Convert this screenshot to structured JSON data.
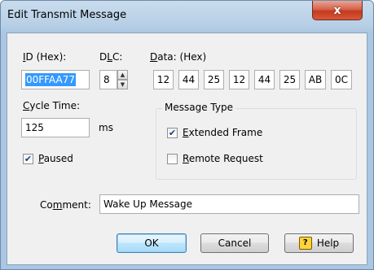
{
  "window": {
    "title": "Edit Transmit Message",
    "close_glyph": "x"
  },
  "id": {
    "label_prefix": "",
    "label_underlined": "I",
    "label_rest": "D (Hex):",
    "value": "00FFAA77"
  },
  "dlc": {
    "label_prefix": "D",
    "label_underlined": "L",
    "label_rest": "C:",
    "value": "8",
    "spin_up_glyph": "▲",
    "spin_down_glyph": "▼"
  },
  "data": {
    "label_prefix": "",
    "label_underlined": "D",
    "label_rest": "ata: (Hex)",
    "bytes": [
      "12",
      "44",
      "25",
      "12",
      "44",
      "25",
      "AB",
      "0C"
    ]
  },
  "cycle_time": {
    "label_prefix": "",
    "label_underlined": "C",
    "label_rest": "ycle Time:",
    "value": "125",
    "unit": "ms"
  },
  "paused": {
    "label_underlined": "P",
    "label_rest": "aused",
    "checked": true
  },
  "message_type": {
    "title": "Message Type",
    "extended_frame": {
      "label_underlined": "E",
      "label_rest": "xtended Frame",
      "checked": true
    },
    "remote_request": {
      "label_underlined": "R",
      "label_rest": "emote Request",
      "checked": false
    }
  },
  "comment": {
    "label_prefix": "Co",
    "label_underlined": "m",
    "label_rest": "ment:",
    "value": "Wake Up Message"
  },
  "buttons": {
    "ok": "OK",
    "cancel": "Cancel",
    "help": "Help",
    "help_icon": "?"
  },
  "check_glyph": "✔"
}
